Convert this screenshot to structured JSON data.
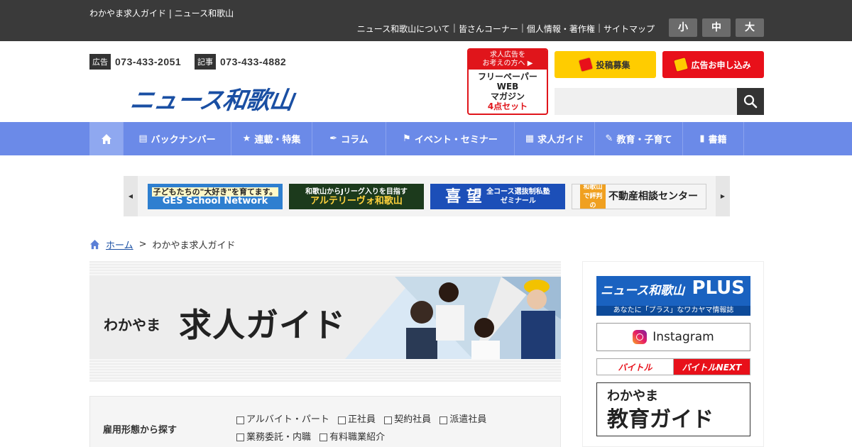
{
  "topbar": {
    "site_title": "わかやま求人ガイド | ニュース和歌山",
    "links": [
      "ニュース和歌山について",
      "皆さんコーナー",
      "個人情報・著作権",
      "サイトマップ"
    ],
    "font_sizes": [
      "小",
      "中",
      "大"
    ]
  },
  "header": {
    "ad_tag": "広告",
    "ad_phone": "073-433-2051",
    "news_tag": "記事",
    "news_phone": "073-433-4882",
    "logo": "ニュース和歌山",
    "freepaper": {
      "head1": "求人広告を",
      "head2": "お考えの方へ",
      "line1": "フリーペーパー",
      "line2": "WEB",
      "line3": "マガジン",
      "line4": "4点セット"
    },
    "post_button": "投稿募集",
    "ad_button": "広告お申し込み",
    "search_placeholder": ""
  },
  "nav": {
    "items": [
      {
        "label": "バックナンバー",
        "icon": "book-icon"
      },
      {
        "label": "連載・特集",
        "icon": "star-icon"
      },
      {
        "label": "コラム",
        "icon": "feather-icon"
      },
      {
        "label": "イベント・セミナー",
        "icon": "flag-icon"
      },
      {
        "label": "求人ガイド",
        "icon": "building-icon"
      },
      {
        "label": "教育・子育て",
        "icon": "pencil-icon"
      },
      {
        "label": "書籍",
        "icon": "book-closed-icon"
      }
    ]
  },
  "carousel": {
    "banners": [
      {
        "line1": "子どもたちの\"大好き\"を育てます。",
        "line2": "GES School Network",
        "color": "#2e7fd0"
      },
      {
        "line1": "和歌山からJリーグ入りを目指す",
        "line2": "アルテリーヴォ和歌山",
        "color": "#1c3a1c"
      },
      {
        "line1": "喜 望",
        "line2": "全コース選抜制私塾 ゼミナール",
        "color": "#1c4fb8"
      },
      {
        "line1": "和歌山で評判の",
        "line2": "不動産相談センター",
        "color": "#f5f5f5"
      }
    ]
  },
  "breadcrumb": {
    "home": "ホーム",
    "current": "わかやま求人ガイド"
  },
  "hero": {
    "small": "わかやま",
    "big": "求人ガイド"
  },
  "filter": {
    "label": "雇用形態から探す",
    "options": [
      "アルバイト・パート",
      "正社員",
      "契約社員",
      "派遣社員",
      "業務委託・内職",
      "有料職業紹介"
    ]
  },
  "sidebar": {
    "plus_title": "ニュース和歌山",
    "plus_word": "PLUS",
    "plus_sub": "あなたに「プラス」なワカヤマ情報誌",
    "instagram": "Instagram",
    "baito1": "バイトル",
    "baito2": "バイトルNEXT",
    "edu1": "わかやま",
    "edu2": "教育ガイド"
  },
  "colors": {
    "nav": "#6b8ae8",
    "topbar": "#3a3a3a",
    "logo": "#1a4fa3",
    "red": "#e8101a",
    "yellow": "#ffcc00"
  }
}
